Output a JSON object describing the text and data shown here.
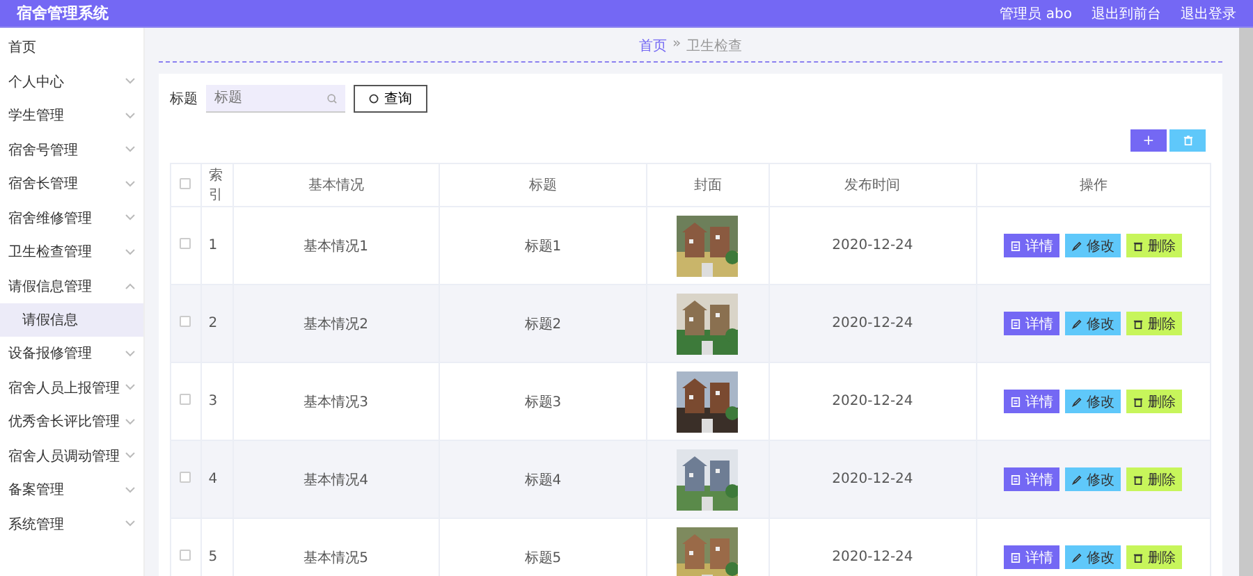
{
  "header": {
    "title": "宿舍管理系统",
    "user": "管理员 abo",
    "links": [
      "退出到前台",
      "退出登录"
    ]
  },
  "sidebar": {
    "items": [
      {
        "label": "首页",
        "selected": false
      },
      {
        "label": "个人中心",
        "selected": false,
        "expanded": false
      },
      {
        "label": "学生管理",
        "selected": false,
        "expanded": false
      },
      {
        "label": "宿舍号管理",
        "selected": false,
        "expanded": false
      },
      {
        "label": "宿舍长管理",
        "selected": false,
        "expanded": false
      },
      {
        "label": "宿舍维修管理",
        "selected": false,
        "expanded": false
      },
      {
        "label": "卫生检查管理",
        "selected": false,
        "expanded": false
      },
      {
        "label": "请假信息管理",
        "selected": false,
        "expanded": true,
        "children": [
          {
            "label": "请假信息",
            "selected": true
          }
        ]
      },
      {
        "label": "设备报修管理",
        "selected": false,
        "expanded": false
      },
      {
        "label": "宿舍人员上报管理",
        "selected": false,
        "expanded": false
      },
      {
        "label": "优秀舍长评比管理",
        "selected": false,
        "expanded": false
      },
      {
        "label": "宿舍人员调动管理",
        "selected": false,
        "expanded": false
      },
      {
        "label": "备案管理",
        "selected": false,
        "expanded": false
      },
      {
        "label": "系统管理",
        "selected": false,
        "expanded": false
      }
    ]
  },
  "breadcrumb": [
    "首页",
    "»",
    "卫生检查"
  ],
  "search": {
    "label": "标题",
    "placeholder": "标题",
    "button": "查询"
  },
  "actions": [
    {
      "kind": "add",
      "label": "+"
    },
    {
      "kind": "delete"
    }
  ],
  "table": {
    "header_checked": false,
    "columns": [
      "索引",
      "基本情况",
      "标题",
      "封面",
      "发布时间",
      "操作"
    ],
    "rows": [
      {
        "checked": false,
        "index": "1",
        "info": "基本情况1",
        "title": "标题1",
        "date": "2020-12-24",
        "buttons": [
          "详情",
          "修改",
          "删除"
        ]
      },
      {
        "checked": false,
        "index": "2",
        "info": "基本情况2",
        "title": "标题2",
        "date": "2020-12-24",
        "buttons": [
          "详情",
          "修改",
          "删除"
        ]
      },
      {
        "checked": false,
        "index": "3",
        "info": "基本情况3",
        "title": "标题3",
        "date": "2020-12-24",
        "buttons": [
          "详情",
          "修改",
          "删除"
        ]
      },
      {
        "checked": false,
        "index": "4",
        "info": "基本情况4",
        "title": "标题4",
        "date": "2020-12-24",
        "buttons": [
          "详情",
          "修改",
          "删除"
        ]
      },
      {
        "checked": false,
        "index": "5",
        "info": "基本情况5",
        "title": "标题5",
        "date": "2020-12-24",
        "buttons": [
          "详情",
          "修改",
          "删除"
        ]
      }
    ]
  }
}
